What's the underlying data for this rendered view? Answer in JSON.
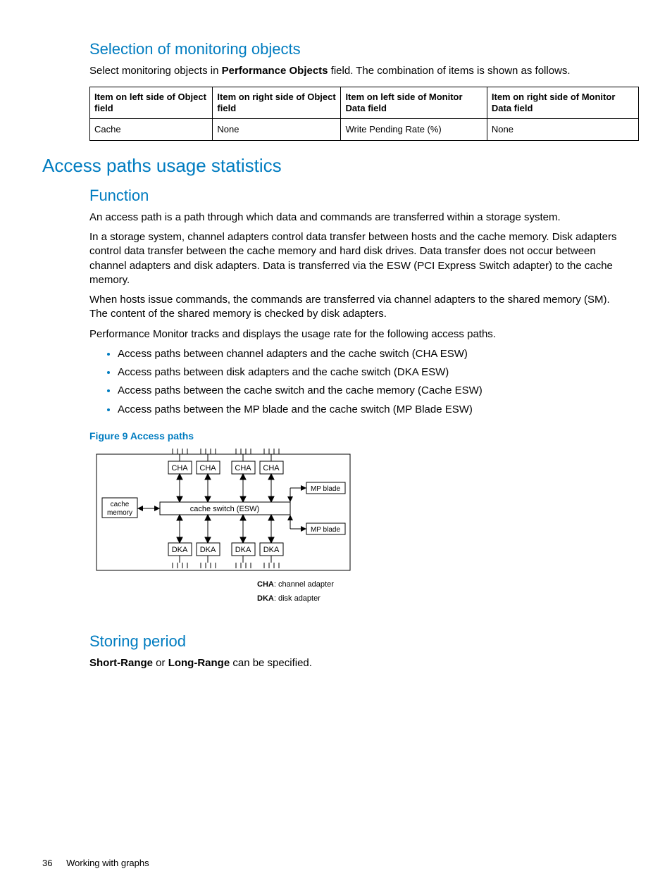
{
  "section1": {
    "heading": "Selection of monitoring objects",
    "para_pre": "Select monitoring objects in ",
    "para_bold": "Performance Objects",
    "para_post": " field. The combination of items is shown as follows."
  },
  "table": {
    "headers": [
      "Item on left side of Object field",
      "Item on right side of Object field",
      "Item on left side of Monitor Data field",
      "Item on right side of Monitor Data field"
    ],
    "row": [
      "Cache",
      "None",
      "Write Pending Rate (%)",
      "None"
    ]
  },
  "section2": {
    "heading": "Access paths usage statistics",
    "sub_function": "Function",
    "p1": "An access path is a path through which data and commands are transferred within a storage system.",
    "p2": "In a storage system, channel adapters control data transfer between hosts and the cache memory. Disk adapters control data transfer between the cache memory and hard disk drives. Data transfer does not occur between channel adapters and disk adapters. Data is transferred via the ESW (PCI Express Switch adapter) to the cache memory.",
    "p3": "When hosts issue commands, the commands are transferred via channel adapters to the shared memory (SM). The content of the shared memory is checked by disk adapters.",
    "p4": "Performance Monitor tracks and displays the usage rate for the following access paths.",
    "bullets": [
      "Access paths between channel adapters and the cache switch (CHA ESW)",
      "Access paths between disk adapters and the cache switch (DKA ESW)",
      "Access paths between the cache switch and the cache memory (Cache ESW)",
      "Access paths between the MP blade and the cache switch (MP Blade ESW)"
    ],
    "figcap": "Figure 9 Access paths",
    "diagram": {
      "cha": "CHA",
      "cache_memory_1": "cache",
      "cache_memory_2": "memory",
      "cache_switch": "cache switch (ESW)",
      "mp_blade": "MP blade",
      "dka": "DKA",
      "legend_cha_b": "CHA",
      "legend_cha_t": ": channel adapter",
      "legend_dka_b": "DKA",
      "legend_dka_t": ": disk adapter"
    },
    "sub_storing": "Storing period",
    "storing_pre": "",
    "storing_b1": "Short-Range",
    "storing_mid": " or ",
    "storing_b2": "Long-Range",
    "storing_post": " can be specified."
  },
  "footer": {
    "pagenum": "36",
    "chapter": "Working with graphs"
  }
}
